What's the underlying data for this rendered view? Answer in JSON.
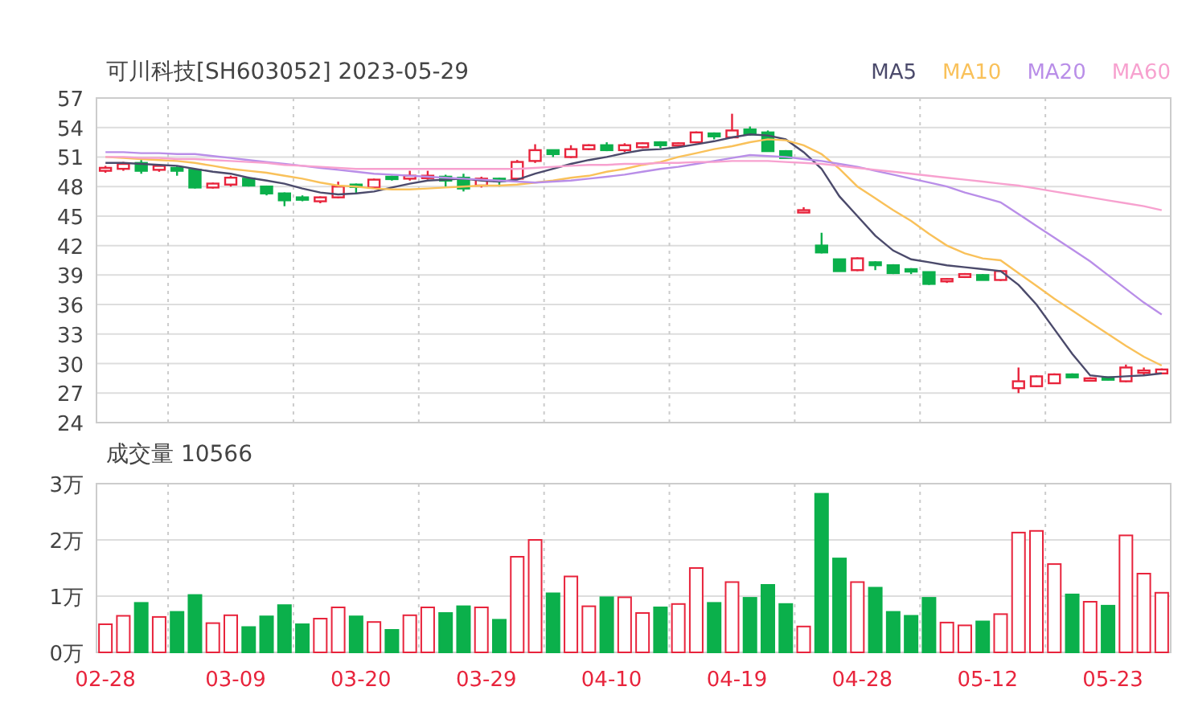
{
  "header": {
    "title": "可川科技[SH603052] 2023-05-29"
  },
  "price_chart": {
    "chart_data": {
      "type": "candlestick",
      "grid": true,
      "categories": [
        null,
        null,
        null,
        null,
        null,
        null,
        null,
        null,
        null,
        null,
        null,
        null,
        null,
        null,
        null,
        null,
        null,
        null,
        null,
        null,
        null,
        null,
        null,
        null,
        null,
        null,
        null,
        null,
        null,
        null,
        null,
        null,
        null,
        null,
        null,
        null,
        null,
        null,
        null,
        null,
        null,
        null,
        null,
        null,
        null,
        null,
        null,
        null,
        null,
        null,
        null,
        null,
        null,
        null,
        null,
        null,
        null,
        null,
        null,
        null
      ],
      "ylim": [
        24,
        57
      ],
      "yticks": [
        24,
        27,
        30,
        33,
        36,
        39,
        42,
        45,
        48,
        51,
        54,
        57
      ],
      "ohlc": [
        [
          49.6,
          50.1,
          49.4,
          49.9
        ],
        [
          49.8,
          50.5,
          49.6,
          50.3
        ],
        [
          50.4,
          50.7,
          49.3,
          49.6
        ],
        [
          49.7,
          50.3,
          49.5,
          50.1
        ],
        [
          49.9,
          50.1,
          49.1,
          49.6
        ],
        [
          49.7,
          49.8,
          47.8,
          47.9
        ],
        [
          47.9,
          48.4,
          47.8,
          48.3
        ],
        [
          48.2,
          49.1,
          48.0,
          48.9
        ],
        [
          48.8,
          49.0,
          48.0,
          48.1
        ],
        [
          48.0,
          48.1,
          47.1,
          47.3
        ],
        [
          47.3,
          47.4,
          46.0,
          46.6
        ],
        [
          46.9,
          47.1,
          46.5,
          46.7
        ],
        [
          46.5,
          47.0,
          46.3,
          46.9
        ],
        [
          46.9,
          48.5,
          46.8,
          48.0
        ],
        [
          48.2,
          48.3,
          47.3,
          48.1
        ],
        [
          47.9,
          48.8,
          47.8,
          48.7
        ],
        [
          49.0,
          49.1,
          48.6,
          48.8
        ],
        [
          48.8,
          49.6,
          48.6,
          49.1
        ],
        [
          48.9,
          49.6,
          48.7,
          49.1
        ],
        [
          49.0,
          49.2,
          48.0,
          48.6
        ],
        [
          48.9,
          49.3,
          47.5,
          47.8
        ],
        [
          48.1,
          49.0,
          47.9,
          48.8
        ],
        [
          48.8,
          48.9,
          48.0,
          48.6
        ],
        [
          48.8,
          50.7,
          48.8,
          50.5
        ],
        [
          50.6,
          52.3,
          50.4,
          51.7
        ],
        [
          51.7,
          51.7,
          51.0,
          51.3
        ],
        [
          51.0,
          52.2,
          50.9,
          51.8
        ],
        [
          51.8,
          52.3,
          51.7,
          52.2
        ],
        [
          52.2,
          52.5,
          51.6,
          51.7
        ],
        [
          51.7,
          52.4,
          51.5,
          52.2
        ],
        [
          52.0,
          52.5,
          51.9,
          52.4
        ],
        [
          52.5,
          52.6,
          51.9,
          52.2
        ],
        [
          52.2,
          52.5,
          52.0,
          52.4
        ],
        [
          52.5,
          53.6,
          52.4,
          53.5
        ],
        [
          53.4,
          53.5,
          52.8,
          53.1
        ],
        [
          53.0,
          55.4,
          52.9,
          53.7
        ],
        [
          53.8,
          54.1,
          53.2,
          53.3
        ],
        [
          53.5,
          53.7,
          51.6,
          51.6
        ],
        [
          51.6,
          51.7,
          50.9,
          50.9
        ],
        [
          45.4,
          45.9,
          45.3,
          45.6
        ],
        [
          42.0,
          43.3,
          41.2,
          41.3
        ],
        [
          40.6,
          40.6,
          39.4,
          39.4
        ],
        [
          39.5,
          40.8,
          39.4,
          40.7
        ],
        [
          40.3,
          40.4,
          39.5,
          40.0
        ],
        [
          40.0,
          40.1,
          39.1,
          39.2
        ],
        [
          39.6,
          39.7,
          39.1,
          39.5
        ],
        [
          39.3,
          39.3,
          38.0,
          38.1
        ],
        [
          38.4,
          38.7,
          38.2,
          38.6
        ],
        [
          38.8,
          39.2,
          38.7,
          39.1
        ],
        [
          39.0,
          39.1,
          38.5,
          38.5
        ],
        [
          38.5,
          39.4,
          38.4,
          39.4
        ],
        [
          27.5,
          29.6,
          27.0,
          28.2
        ],
        [
          27.7,
          28.8,
          27.6,
          28.7
        ],
        [
          28.0,
          29.0,
          28.0,
          28.9
        ],
        [
          28.9,
          29.0,
          28.6,
          28.6
        ],
        [
          28.3,
          28.6,
          28.3,
          28.5
        ],
        [
          28.6,
          28.6,
          28.3,
          28.4
        ],
        [
          28.2,
          29.9,
          28.1,
          29.6
        ],
        [
          29.1,
          29.6,
          28.8,
          29.3
        ],
        [
          29.0,
          29.5,
          28.9,
          29.4
        ]
      ],
      "series": [
        {
          "name": "MA5",
          "type": "line",
          "color": "#4b4a6b",
          "values": [
            50.4,
            50.4,
            50.3,
            50.2,
            50.1,
            49.8,
            49.5,
            49.3,
            48.9,
            48.6,
            48.3,
            47.8,
            47.4,
            47.2,
            47.3,
            47.5,
            47.9,
            48.3,
            48.6,
            48.7,
            48.8,
            48.6,
            48.5,
            48.7,
            49.3,
            49.8,
            50.3,
            50.7,
            51.0,
            51.4,
            51.7,
            51.8,
            52.0,
            52.3,
            52.6,
            53.0,
            53.3,
            53.2,
            52.8,
            51.5,
            49.8,
            47.0,
            45.0,
            43.0,
            41.5,
            40.6,
            40.3,
            40.0,
            39.8,
            39.6,
            39.4,
            38.0,
            36.0,
            33.5,
            31.0,
            28.8,
            28.6,
            28.7,
            28.8,
            29.0
          ]
        },
        {
          "name": "MA10",
          "type": "line",
          "color": "#f9c15a",
          "values": [
            51.0,
            50.9,
            50.8,
            50.7,
            50.6,
            50.4,
            50.1,
            49.8,
            49.6,
            49.4,
            49.1,
            48.8,
            48.4,
            48.1,
            48.0,
            47.8,
            47.7,
            47.7,
            47.8,
            47.9,
            48.0,
            48.1,
            48.1,
            48.2,
            48.4,
            48.6,
            48.9,
            49.1,
            49.5,
            49.8,
            50.2,
            50.5,
            51.0,
            51.4,
            51.8,
            52.1,
            52.5,
            52.8,
            52.7,
            52.2,
            51.3,
            49.8,
            48.0,
            46.8,
            45.6,
            44.5,
            43.2,
            42.0,
            41.2,
            40.7,
            40.5,
            39.2,
            37.9,
            36.6,
            35.4,
            34.2,
            33.0,
            31.8,
            30.7,
            29.8
          ]
        },
        {
          "name": "MA20",
          "type": "line",
          "color": "#b98ee8",
          "values": [
            51.5,
            51.5,
            51.4,
            51.4,
            51.3,
            51.3,
            51.1,
            50.9,
            50.7,
            50.5,
            50.3,
            50.1,
            49.9,
            49.7,
            49.5,
            49.3,
            49.2,
            49.1,
            49.0,
            48.9,
            48.8,
            48.7,
            48.6,
            48.5,
            48.4,
            48.5,
            48.6,
            48.8,
            49.0,
            49.2,
            49.5,
            49.8,
            50.0,
            50.3,
            50.6,
            50.9,
            51.2,
            51.1,
            51.0,
            50.8,
            50.6,
            50.3,
            50.0,
            49.6,
            49.2,
            48.8,
            48.4,
            48.0,
            47.4,
            46.9,
            46.4,
            45.2,
            44.0,
            42.8,
            41.6,
            40.4,
            39.0,
            37.6,
            36.2,
            35.0
          ]
        },
        {
          "name": "MA60",
          "type": "line",
          "color": "#f7a1cf",
          "values": [
            51.0,
            51.0,
            50.9,
            50.9,
            50.8,
            50.8,
            50.7,
            50.6,
            50.5,
            50.4,
            50.2,
            50.1,
            50.0,
            49.9,
            49.8,
            49.8,
            49.8,
            49.8,
            49.8,
            49.8,
            49.8,
            49.8,
            49.8,
            49.8,
            49.9,
            50.0,
            50.1,
            50.2,
            50.2,
            50.3,
            50.3,
            50.4,
            50.4,
            50.5,
            50.5,
            50.6,
            50.6,
            50.6,
            50.5,
            50.4,
            50.3,
            50.1,
            49.9,
            49.7,
            49.5,
            49.3,
            49.1,
            48.9,
            48.7,
            48.5,
            48.3,
            48.1,
            47.8,
            47.5,
            47.2,
            46.9,
            46.6,
            46.3,
            46.0,
            45.6
          ]
        }
      ]
    }
  },
  "volume_chart": {
    "title": "成交量 10566",
    "chart_data": {
      "type": "bar",
      "grid": true,
      "ylim": [
        0,
        3
      ],
      "yticks": [
        {
          "value": 0,
          "label": "0万"
        },
        {
          "value": 1,
          "label": "1万"
        },
        {
          "value": 2,
          "label": "2万"
        },
        {
          "value": 3,
          "label": "3万"
        }
      ],
      "categories": [
        "02-28",
        null,
        null,
        null,
        null,
        null,
        null,
        "03-09",
        null,
        null,
        null,
        null,
        null,
        null,
        "03-20",
        null,
        null,
        null,
        null,
        null,
        null,
        "03-29",
        null,
        null,
        null,
        null,
        null,
        null,
        "04-10",
        null,
        null,
        null,
        null,
        null,
        null,
        "04-19",
        null,
        null,
        null,
        null,
        null,
        null,
        "04-28",
        null,
        null,
        null,
        null,
        null,
        null,
        "05-12",
        null,
        null,
        null,
        null,
        null,
        null,
        "05-23",
        null,
        null,
        null
      ],
      "values": [
        0.5,
        0.65,
        0.88,
        0.63,
        0.72,
        1.02,
        0.52,
        0.66,
        0.45,
        0.64,
        0.84,
        0.5,
        0.6,
        0.8,
        0.64,
        0.54,
        0.4,
        0.66,
        0.8,
        0.7,
        0.82,
        0.8,
        0.58,
        1.7,
        2.0,
        1.05,
        1.35,
        0.82,
        0.98,
        0.98,
        0.7,
        0.8,
        0.86,
        1.5,
        0.88,
        1.25,
        0.97,
        1.2,
        0.86,
        0.46,
        2.82,
        1.67,
        1.25,
        1.15,
        0.72,
        0.65,
        0.97,
        0.53,
        0.48,
        0.55,
        0.68,
        2.13,
        2.16,
        1.57,
        1.03,
        0.9,
        0.83,
        2.08,
        1.4,
        1.06
      ]
    }
  }
}
